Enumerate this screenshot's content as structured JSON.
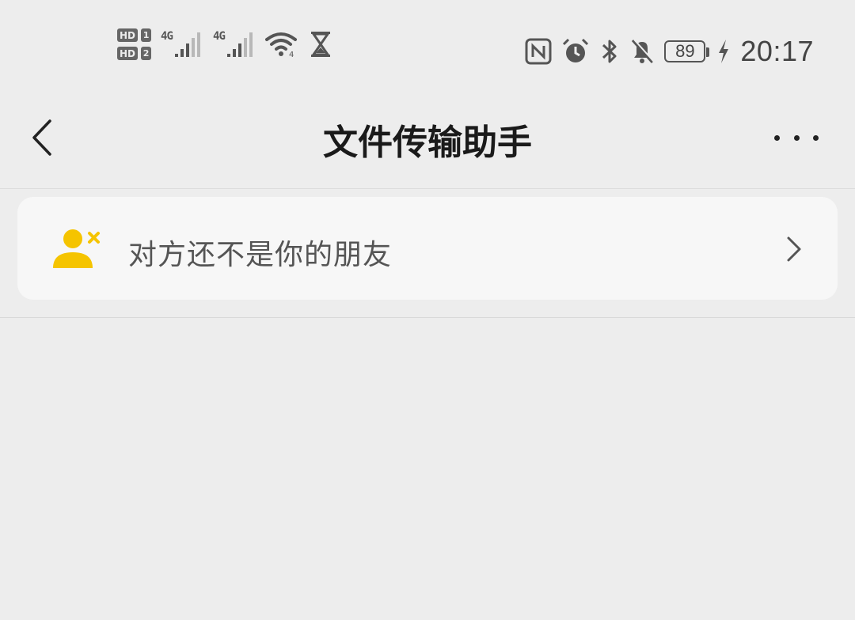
{
  "status_bar": {
    "hd_label": "HD",
    "sim1": "1",
    "sim2": "2",
    "net1": "4G",
    "net2": "4G",
    "wifi_sub": "4",
    "battery": "89",
    "time": "20:17"
  },
  "header": {
    "title": "文件传输助手",
    "back_icon": "chevron-left-icon",
    "more_icon": "more-icon"
  },
  "notice": {
    "text": "对方还不是你的朋友",
    "icon": "user-remove-icon",
    "icon_color": "#f5c400"
  },
  "colors": {
    "background": "#ededed",
    "card": "#f7f7f7",
    "accent": "#f5c400"
  }
}
